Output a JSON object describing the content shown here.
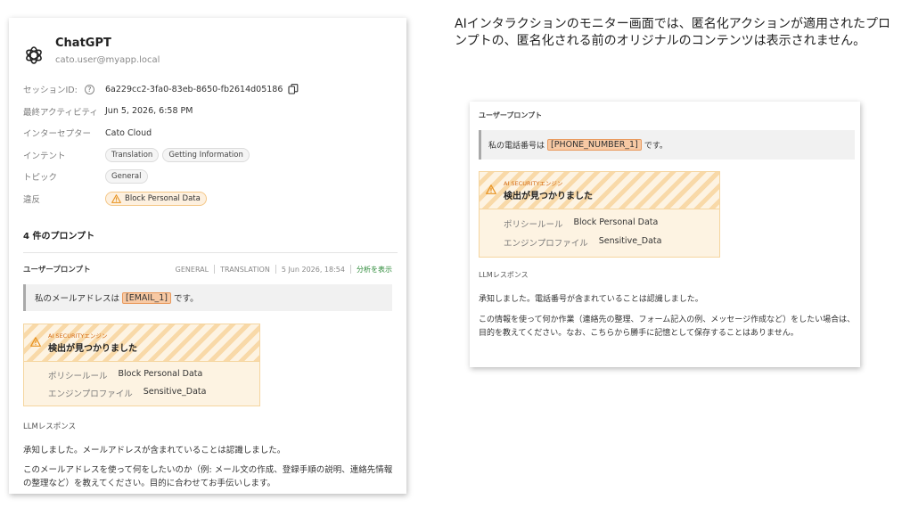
{
  "left": {
    "app_name": "ChatGPT",
    "user": "cato.user@myapp.local",
    "session_key": "セッションID:",
    "help_glyph": "?",
    "session_value": "6a229cc2-3fa0-83eb-8650-fb2614d05186",
    "activity_key": "最終アクティビティ",
    "activity_value": "Jun 5, 2026, 6:58 PM",
    "interceptor_key": "インターセプター",
    "interceptor_value": "Cato Cloud",
    "intent_key": "インテント",
    "intents": [
      "Translation",
      "Getting Information"
    ],
    "topic_key": "トピック",
    "topic_value": "General",
    "violation_key": "違反",
    "violation_value": "Block Personal Data",
    "prompts_title": "4 件のプロンプト",
    "prompt_label": "ユーザープロンプト",
    "meta_general": "GENERAL",
    "meta_translation": "TRANSLATION",
    "meta_time": "5 Jun 2026, 18:54",
    "meta_link": "分析を表示",
    "prompt_before": "私のメールアドレスは",
    "prompt_redacted": "[EMAIL_1]",
    "prompt_after": "です。",
    "engine_eyebrow": "AI SECURITYエンジン",
    "engine_title": "検出が見つかりました",
    "policy_key": "ポリシールール",
    "policy_value": "Block Personal Data",
    "profile_key": "エンジンプロファイル",
    "profile_value": "Sensitive_Data",
    "llm_label": "LLMレスポンス",
    "llm_p1": "承知しました。メールアドレスが含まれていることは認識しました。",
    "llm_p2": "このメールアドレスを使って何をしたいのか（例: メール文の作成、登録手順の説明、連絡先情報の整理など）を教えてください。目的に合わせてお手伝いします。"
  },
  "caption": "AIインタラクションのモニター画面では、匿名化アクションが適用されたプロンプトの、匿名化される前のオリジナルのコンテンツは表示されません。",
  "right": {
    "prompt_label": "ユーザープロンプト",
    "prompt_before": "私の電話番号は",
    "prompt_redacted": "[PHONE_NUMBER_1]",
    "prompt_after": "です。",
    "engine_eyebrow": "AI SECURITYエンジン",
    "engine_title": "検出が見つかりました",
    "policy_key": "ポリシールール",
    "policy_value": "Block Personal Data",
    "profile_key": "エンジンプロファイル",
    "profile_value": "Sensitive_Data",
    "llm_label": "LLMレスポンス",
    "llm_p1": "承知しました。電話番号が含まれていることは認識しました。",
    "llm_p2": "この情報を使って何か作業（連絡先の整理、フォーム記入の例、メッセージ作成など）をしたい場合は、目的を教えてください。なお、こちらから勝手に記憶として保存することはありません。"
  },
  "colors": {
    "redact_bg": "#f7c9a4",
    "warn_orange": "#e8921f",
    "link_green": "#2e8b3a",
    "detect_bg": "#fdf3e2"
  }
}
